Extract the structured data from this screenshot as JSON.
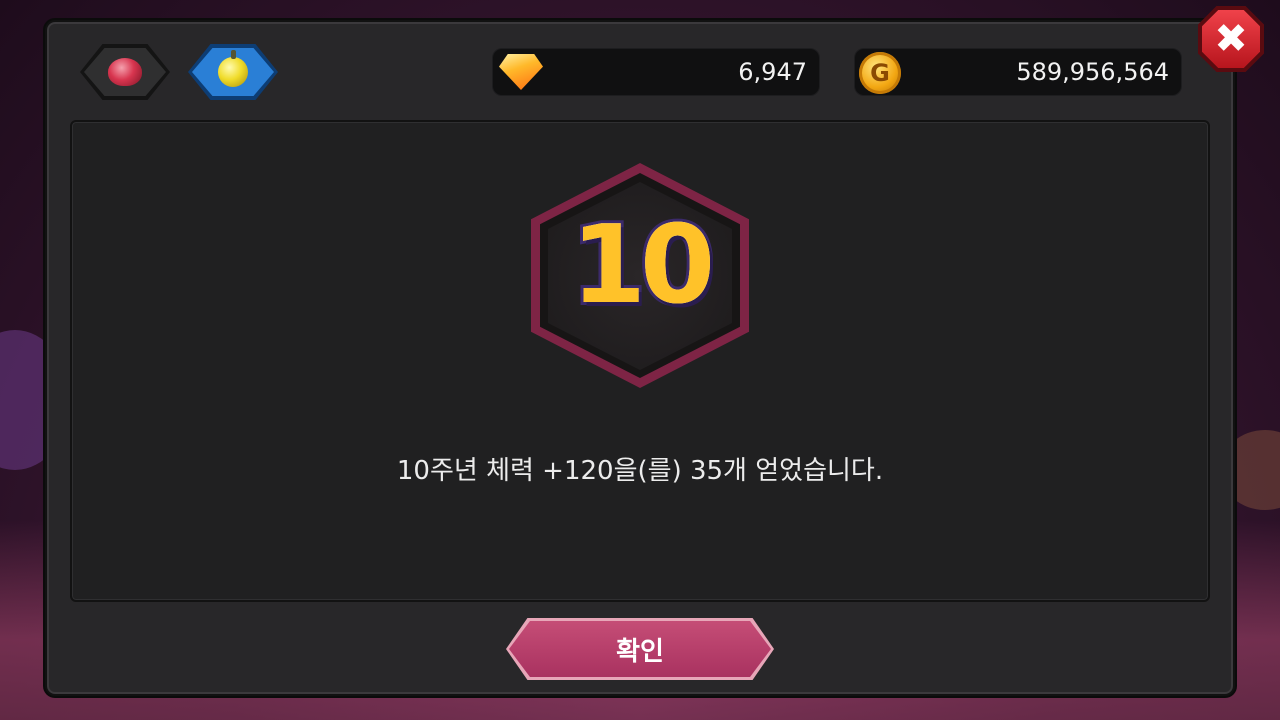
{
  "tabs": [
    {
      "icon": "ruby-icon",
      "selected": false
    },
    {
      "icon": "bomb-icon",
      "selected": true
    }
  ],
  "currency": {
    "gems": {
      "icon": "gem-icon",
      "value": "6,947"
    },
    "gold": {
      "icon": "gold-coin-icon",
      "symbol": "G",
      "value": "589,956,564"
    }
  },
  "close": {
    "icon": "close-icon",
    "label": "✖"
  },
  "reward": {
    "badge_text": "10",
    "message": "10주년 체력 +120을(를) 35개 얻었습니다."
  },
  "confirm": {
    "label": "확인"
  },
  "colors": {
    "panel": "#282729",
    "content": "#202021",
    "badge_border": "#7e2445",
    "confirm": "#b83a69",
    "close": "#d8272f"
  }
}
